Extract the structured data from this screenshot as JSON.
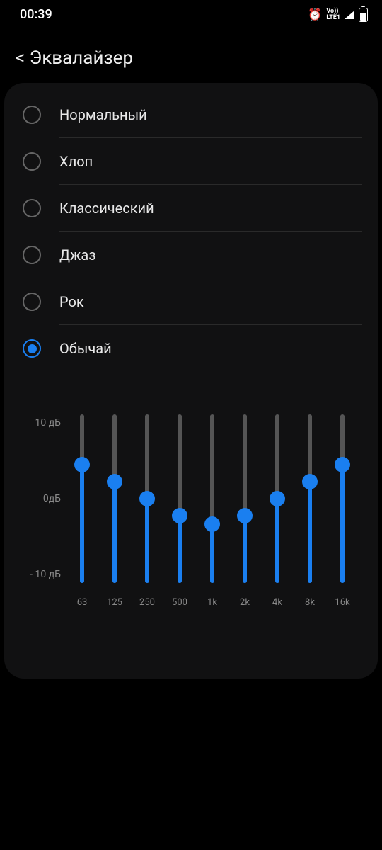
{
  "status_bar": {
    "time": "00:39",
    "net_line1": "Vo))",
    "net_line2": "LTE1"
  },
  "header": {
    "back_prefix": "<",
    "title": "Эквалайзер"
  },
  "presets": [
    {
      "label": "Нормальный",
      "selected": false
    },
    {
      "label": "Хлоп",
      "selected": false
    },
    {
      "label": "Классический",
      "selected": false
    },
    {
      "label": "Джаз",
      "selected": false
    },
    {
      "label": "Рок",
      "selected": false
    },
    {
      "label": "Обычай",
      "selected": true
    }
  ],
  "chart_data": {
    "type": "bar",
    "categories": [
      "63",
      "125",
      "250",
      "500",
      "1k",
      "2k",
      "4k",
      "8k",
      "16k"
    ],
    "values": [
      4,
      2,
      0,
      -2,
      -3,
      -2,
      0,
      2,
      4
    ],
    "ylabel": "",
    "y_ticks": [
      "10 дБ",
      "0дБ",
      "- 10 дБ"
    ],
    "ylim": [
      -10,
      10
    ]
  }
}
